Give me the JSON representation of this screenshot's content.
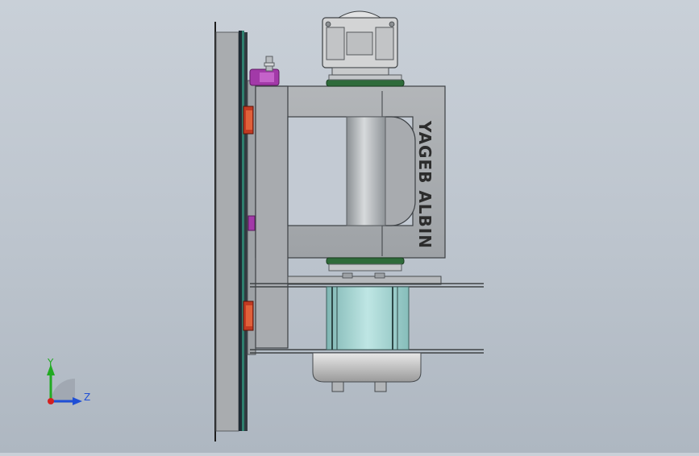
{
  "model_label": "YAGEB ALBIN",
  "triad": {
    "y_label": "Y",
    "z_label": "Z",
    "y_color": "#22aa22",
    "z_color": "#1f4fd6",
    "x_color": "#d42020"
  },
  "colors": {
    "background": "#c3cad3",
    "frame_gray": "#a3a7ab",
    "plate_dark": "#2a2f33",
    "plate_green": "#2e7f6e",
    "clamp_red": "#c23a22",
    "bracket_magenta": "#a239a8",
    "drum_cyan": "#a6d8d6",
    "seal_green": "#2e6b3a",
    "motor_gray": "#d2d2d2"
  }
}
